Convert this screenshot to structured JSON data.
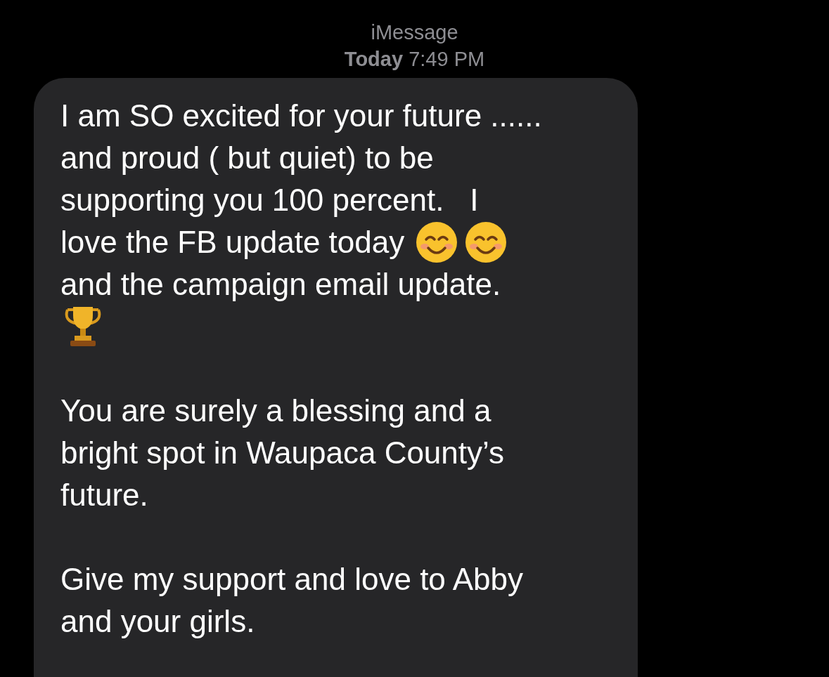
{
  "header": {
    "service": "iMessage",
    "timestamp": "**Today** 7:49 PM"
  },
  "message": {
    "paragraphs": [
      [
        {
          "text": "I am SO excited for your future ......"
        },
        {
          "text": "and proud ( but quiet) to be"
        },
        {
          "text": "supporting you 100 percent.   I"
        },
        {
          "text": "love the FB update today",
          "emoji": [
            {
              "kind": "smiley"
            },
            {
              "kind": "smiley"
            }
          ]
        },
        {
          "text": "and the campaign email update."
        },
        {
          "emoji": [
            {
              "kind": "trophy"
            }
          ]
        }
      ],
      [
        {
          "text": "You are surely a blessing and a"
        },
        {
          "text": "bright spot in Waupaca County’s"
        },
        {
          "text": "future."
        }
      ],
      [
        {
          "text": "Give my support and love to Abby"
        },
        {
          "text": "and your girls."
        }
      ]
    ]
  }
}
